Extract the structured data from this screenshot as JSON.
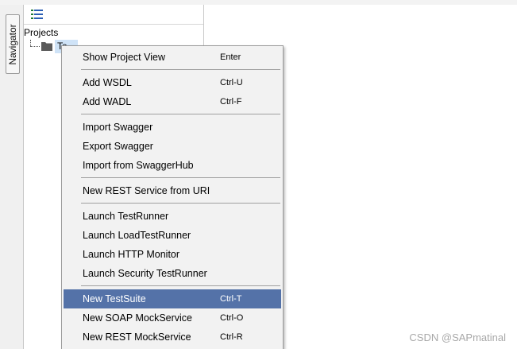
{
  "navigator": {
    "tab_label": "Navigator",
    "projects_label": "Projects",
    "project_name": "Te..."
  },
  "context_menu": {
    "items": [
      {
        "label": "Show Project View",
        "shortcut": "Enter"
      },
      {
        "label": "Add WSDL",
        "shortcut": "Ctrl-U"
      },
      {
        "label": "Add WADL",
        "shortcut": "Ctrl-F"
      },
      {
        "label": "Import Swagger",
        "shortcut": ""
      },
      {
        "label": "Export Swagger",
        "shortcut": ""
      },
      {
        "label": "Import from SwaggerHub",
        "shortcut": ""
      },
      {
        "label": "New REST Service from URI",
        "shortcut": ""
      },
      {
        "label": "Launch TestRunner",
        "shortcut": ""
      },
      {
        "label": "Launch LoadTestRunner",
        "shortcut": ""
      },
      {
        "label": "Launch HTTP Monitor",
        "shortcut": ""
      },
      {
        "label": "Launch Security TestRunner",
        "shortcut": ""
      },
      {
        "label": "New TestSuite",
        "shortcut": "Ctrl-T",
        "highlighted": true
      },
      {
        "label": "New SOAP MockService",
        "shortcut": "Ctrl-O"
      },
      {
        "label": "New REST MockService",
        "shortcut": "Ctrl-R"
      }
    ]
  },
  "colors": {
    "highlight": "#5472a8",
    "selection": "#cfe3f7",
    "menu_background": "#f2f2f2"
  },
  "watermark": "CSDN @SAPmatinal"
}
